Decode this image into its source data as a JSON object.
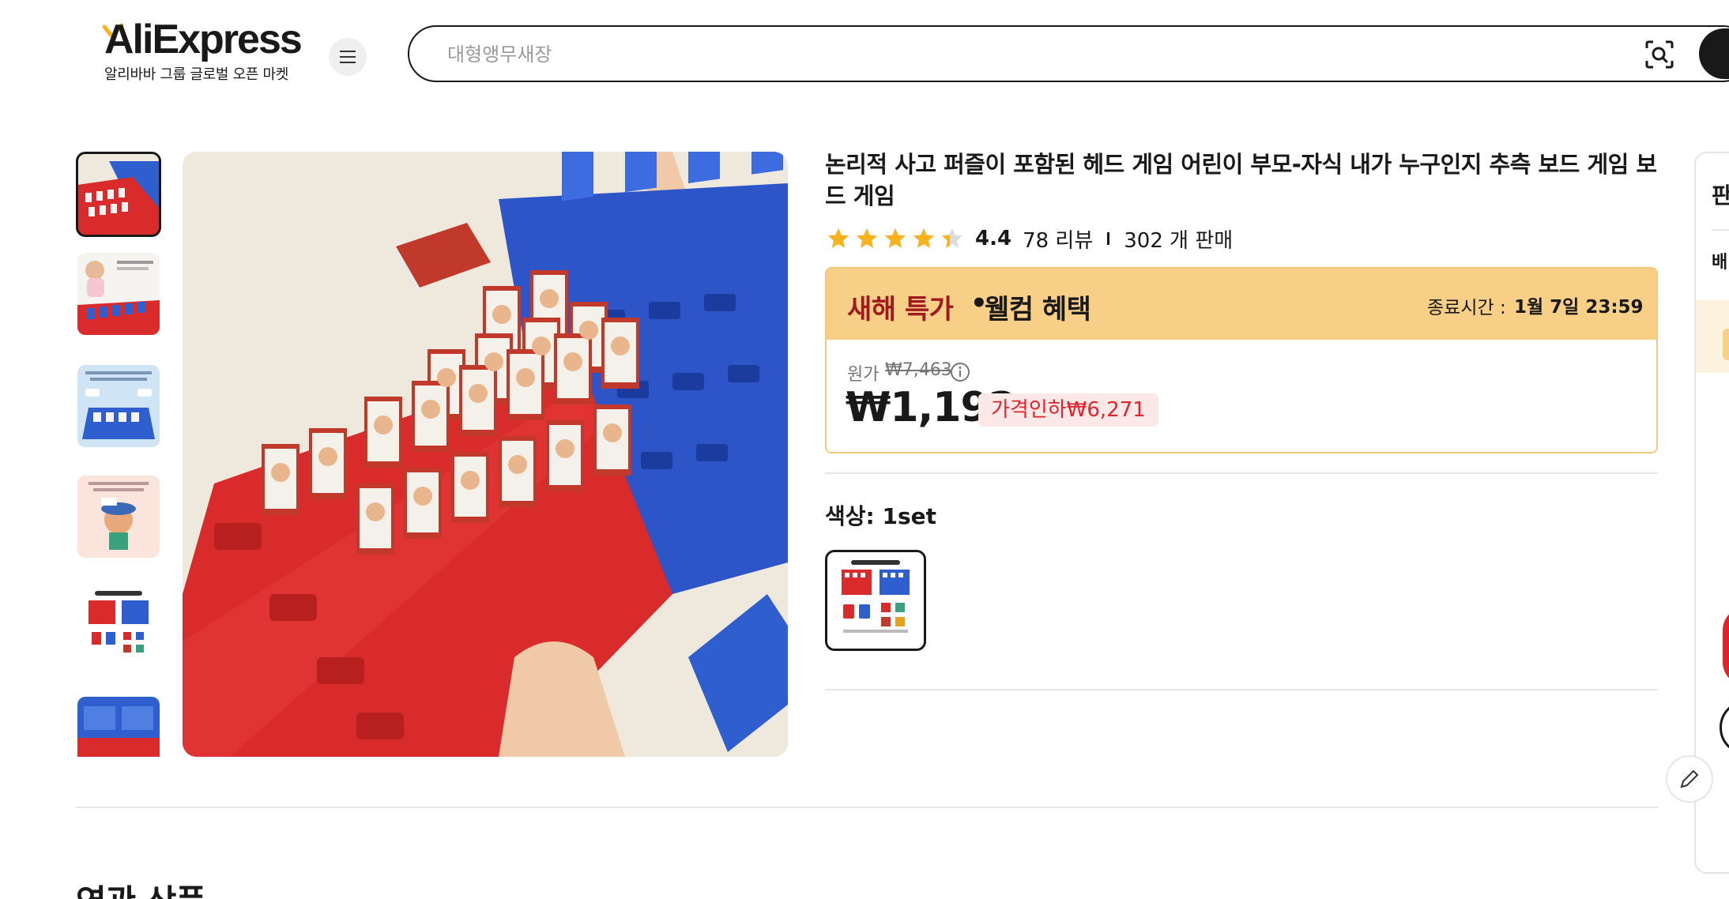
{
  "header": {
    "logo_text": "AliExpress",
    "logo_subtitle": "알리바바 그룹 글로벌 오픈 마켓",
    "search_placeholder": "대형앵무새장"
  },
  "product": {
    "title": "논리적 사고 퍼즐이 포함된 헤드 게임 어린이 부모-자식 내가 누구인지 추측 보드 게임 보드 게임",
    "rating": "4.4",
    "rating_stars": 4.4,
    "reviews": "78 리뷰",
    "sold": "302 개 판매"
  },
  "deal": {
    "title": "새해 특가",
    "separator": "•",
    "subtitle": "웰컴 혜택",
    "end_label": "종료시간 :",
    "end_time": "1월 7일 23:59",
    "original_label": "원가",
    "original_price": "₩7,463",
    "price": "₩1,192",
    "discount": "가격인하₩6,271"
  },
  "variants": {
    "label": "색상: 1set"
  },
  "related": {
    "title": "연관 상품"
  },
  "side_panel": {
    "text1": "판",
    "text2": "배"
  },
  "icons": {
    "menu": "menu-icon",
    "camera": "camera-search-icon",
    "star": "star-icon",
    "info": "info-icon",
    "edit": "edit-icon"
  },
  "colors": {
    "deal_header": "#f7cf86",
    "deal_red": "#a1181e",
    "discount_red": "#e0242b",
    "star": "#f9b21b"
  }
}
